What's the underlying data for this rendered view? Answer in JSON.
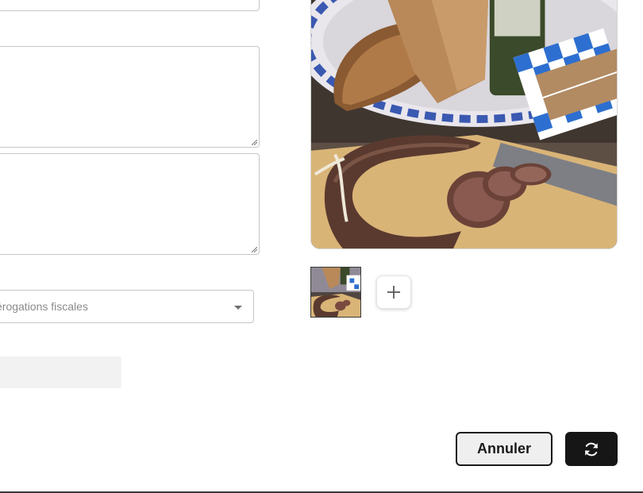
{
  "form": {
    "select": {
      "value": "érogations fiscales"
    }
  },
  "gallery": {
    "main_image": "charcuterie-photo",
    "thumbnail": "charcuterie-thumbnail",
    "add_icon": "plus-icon"
  },
  "actions": {
    "cancel_label": "Annuler",
    "refresh_icon": "refresh-icon"
  },
  "colors": {
    "primary_button": "#161616",
    "secondary_button": "#efefef",
    "border": "#c6c6c6"
  }
}
